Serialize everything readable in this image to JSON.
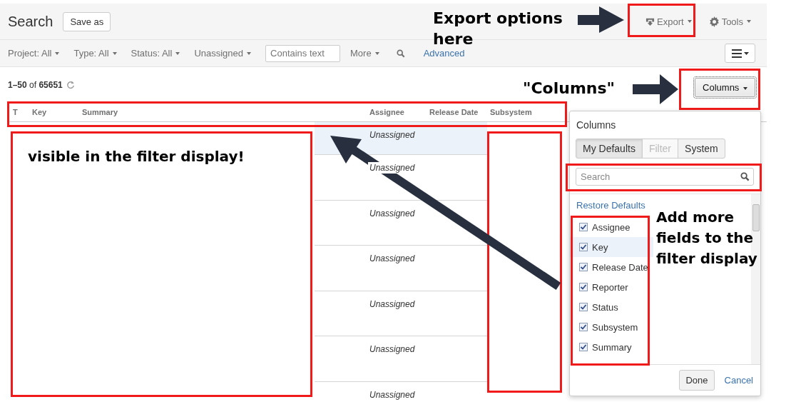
{
  "header": {
    "title": "Search",
    "save_button": "Save as",
    "export_button": "Export",
    "tools_button": "Tools"
  },
  "filters": [
    {
      "kind": "dropdown",
      "label": "Project: All"
    },
    {
      "kind": "dropdown",
      "label": "Type: All"
    },
    {
      "kind": "dropdown",
      "label": "Status: All"
    },
    {
      "kind": "dropdown",
      "label": "Unassigned"
    },
    {
      "kind": "field",
      "placeholder": "Contains text"
    },
    {
      "kind": "dropdown",
      "label": "More"
    },
    {
      "kind": "search"
    },
    {
      "kind": "link",
      "label": "Advanced"
    }
  ],
  "results": {
    "count": "**1–50** of **65651**",
    "columns_button": "Columns"
  },
  "table": {
    "columns": [
      "T",
      "Key",
      "Summary",
      "Assignee",
      "Release Date",
      "Subsystem"
    ],
    "rows": [
      {
        "assignee": "Unassigned",
        "selected": true
      },
      {
        "assignee": "Unassigned",
        "selected": false
      },
      {
        "assignee": "Unassigned",
        "selected": false
      },
      {
        "assignee": "Unassigned",
        "selected": false
      },
      {
        "assignee": "Unassigned",
        "selected": false
      },
      {
        "assignee": "Unassigned",
        "selected": false
      },
      {
        "assignee": "Unassigned",
        "selected": false
      }
    ]
  },
  "columns_popup": {
    "title": "Columns",
    "tabs": [
      {
        "label": "My Defaults",
        "selected": true,
        "disabled": false
      },
      {
        "label": "Filter",
        "selected": false,
        "disabled": true
      },
      {
        "label": "System",
        "selected": false,
        "disabled": false
      }
    ],
    "search": {
      "placeholder": "Search"
    },
    "restore_link": "Restore Defaults",
    "fields": [
      {
        "label": "Assignee",
        "checked": true,
        "selected": false
      },
      {
        "label": "Key",
        "checked": true,
        "selected": true
      },
      {
        "label": "Release Date",
        "checked": true,
        "selected": false
      },
      {
        "label": "Reporter",
        "checked": true,
        "selected": false
      },
      {
        "label": "Status",
        "checked": true,
        "selected": false
      },
      {
        "label": "Subsystem",
        "checked": true,
        "selected": false
      },
      {
        "label": "Summary",
        "checked": true,
        "selected": false
      }
    ],
    "done_button": "Done",
    "cancel_link": "Cancel"
  },
  "annotations": [
    "Export options here",
    "\"Columns\"",
    "visible in the filter display!",
    "Add more fields to the filter display"
  ]
}
